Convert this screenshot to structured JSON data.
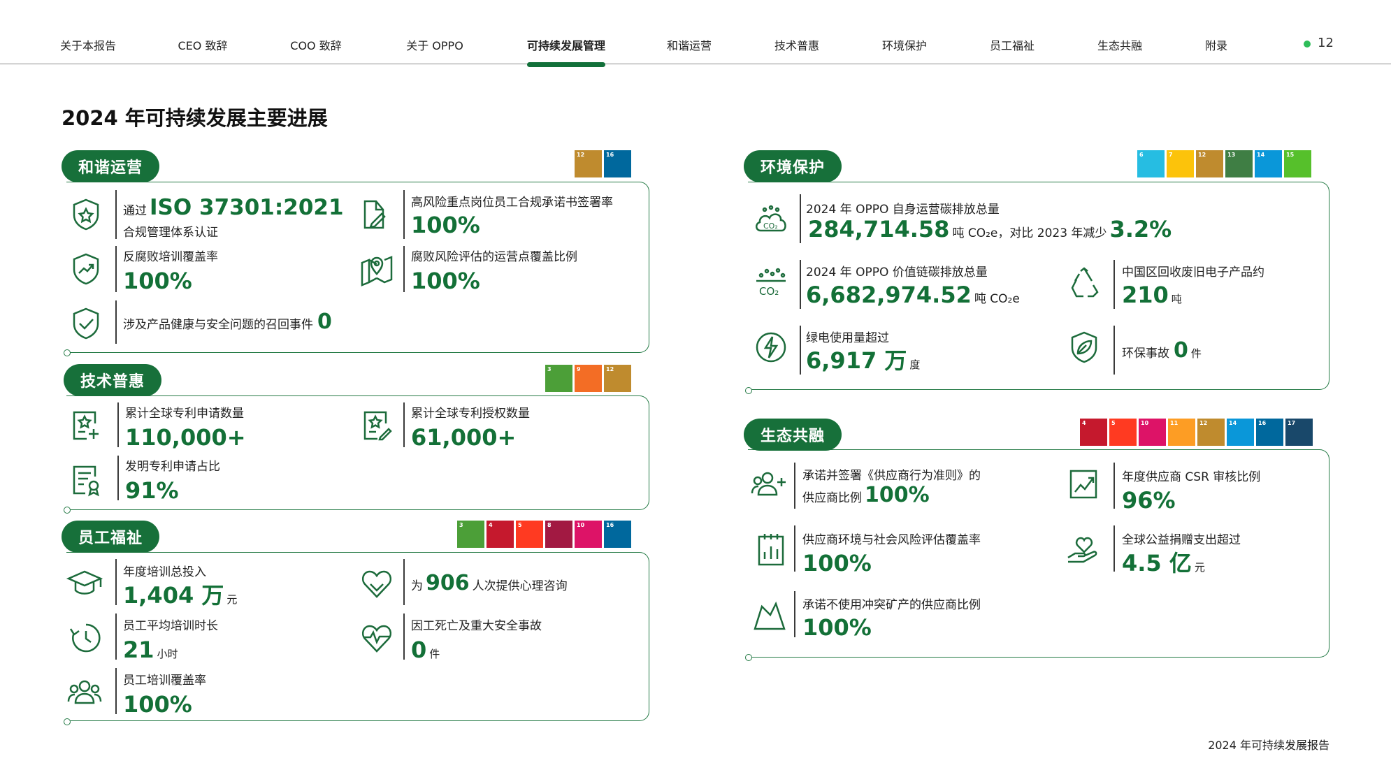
{
  "nav": {
    "items": [
      "关于本报告",
      "CEO 致辞",
      "COO 致辞",
      "关于 OPPO",
      "可持续发展管理",
      "和谐运营",
      "技术普惠",
      "环境保护",
      "员工福祉",
      "生态共融",
      "附录"
    ],
    "page": "12"
  },
  "title": "2024 年可持续发展主要进展",
  "footer": "2024 年可持续发展报告",
  "colors": {
    "accent": "#17703a",
    "dot": "#2ebd59"
  },
  "harmony": {
    "label": "和谐运营",
    "sdgs": [
      "12",
      "16"
    ],
    "iso_prefix": "通过",
    "iso_value": "ISO 37301:2021",
    "iso_sub": "合规管理体系认证",
    "sign_label": "高风险重点岗位员工合规承诺书签署率",
    "sign_value": "100%",
    "anticorr_label": "反腐败培训覆盖率",
    "anticorr_value": "100%",
    "risk_label": "腐败风险评估的运营点覆盖比例",
    "risk_value": "100%",
    "recall_label": "涉及产品健康与安全问题的召回事件",
    "recall_value": "0"
  },
  "tech": {
    "label": "技术普惠",
    "sdgs": [
      "3",
      "9",
      "12"
    ],
    "apply_label": "累计全球专利申请数量",
    "apply_value": "110,000+",
    "grant_label": "累计全球专利授权数量",
    "grant_value": "61,000+",
    "invent_label": "发明专利申请占比",
    "invent_value": "91%"
  },
  "staff": {
    "label": "员工福祉",
    "sdgs": [
      "3",
      "4",
      "5",
      "8",
      "10",
      "16"
    ],
    "invest_label": "年度培训总投入",
    "invest_value": "1,404",
    "invest_unit_big": "万",
    "invest_unit": "元",
    "psy_prefix": "为",
    "psy_value": "906",
    "psy_suffix": "人次提供心理咨询",
    "hours_label": "员工平均培训时长",
    "hours_value": "21",
    "hours_unit": "小时",
    "death_label": "因工死亡及重大安全事故",
    "death_value": "0",
    "death_unit": "件",
    "cover_label": "员工培训覆盖率",
    "cover_value": "100%"
  },
  "env": {
    "label": "环境保护",
    "sdgs": [
      "6",
      "7",
      "12",
      "13",
      "14",
      "15"
    ],
    "own_label": "2024 年 OPPO 自身运营碳排放总量",
    "own_value": "284,714.58",
    "own_unit": "吨 CO₂e，对比 2023 年减少",
    "own_reduce": "3.2%",
    "chain_label": "2024 年 OPPO 价值链碳排放总量",
    "chain_value": "6,682,974.52",
    "chain_unit": "吨 CO₂e",
    "recycle_label": "中国区回收废旧电子产品约",
    "recycle_value": "210",
    "recycle_unit": "吨",
    "green_label": "绿电使用量超过",
    "green_value": "6,917",
    "green_unit_big": "万",
    "green_unit": "度",
    "accident_label": "环保事故",
    "accident_value": "0",
    "accident_unit": "件"
  },
  "eco": {
    "label": "生态共融",
    "sdgs": [
      "4",
      "5",
      "10",
      "11",
      "12",
      "14",
      "16",
      "17"
    ],
    "code_label1": "承诺并签署《供应商行为准则》的",
    "code_label2": "供应商比例",
    "code_value": "100%",
    "csr_label": "年度供应商 CSR 审核比例",
    "csr_value": "96%",
    "esr_label": "供应商环境与社会风险评估覆盖率",
    "esr_value": "100%",
    "donate_label": "全球公益捐赠支出超过",
    "donate_value": "4.5",
    "donate_unit_big": "亿",
    "donate_unit": "元",
    "mineral_label": "承诺不使用冲突矿产的供应商比例",
    "mineral_value": "100%"
  }
}
